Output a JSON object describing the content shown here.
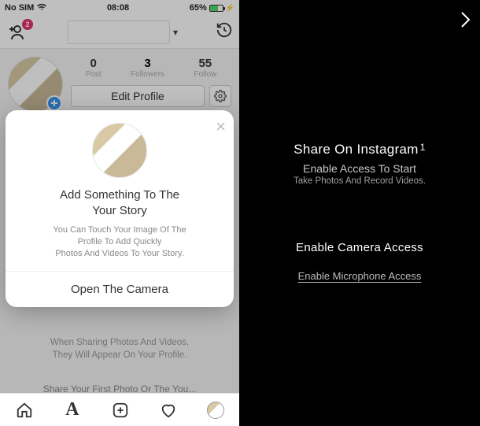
{
  "status": {
    "carrier": "No SIM",
    "time": "08:08",
    "battery_pct": "65%"
  },
  "header": {
    "badge": "2",
    "username": " "
  },
  "profile": {
    "stats": {
      "post_num": "0",
      "post_lbl": "Post",
      "followers_num": "3",
      "followers_lbl": "Followers",
      "follow_num": "55",
      "follow_lbl": "Follow"
    },
    "edit_label": "Edit Profile"
  },
  "modal": {
    "title": "Add Something To The\nYour Story",
    "blurb": "You Can Touch Your Image Of The\nProfile To Add Quickly\nPhotos And Videos To Your Story.",
    "open_camera": "Open The Camera"
  },
  "faint": {
    "line1": "When Sharing Photos And Videos,\nThey Will Appear On Your Profile.",
    "line2": "Share Your First Photo Or The You..."
  },
  "right": {
    "title": "Share On Instagram",
    "sup": "1",
    "sub": "Enable Access To Start",
    "sub2": "Take Photos And Record Videos.",
    "link_cam": "Enable Camera Access",
    "link_mic": "Enable Microphone Access"
  }
}
